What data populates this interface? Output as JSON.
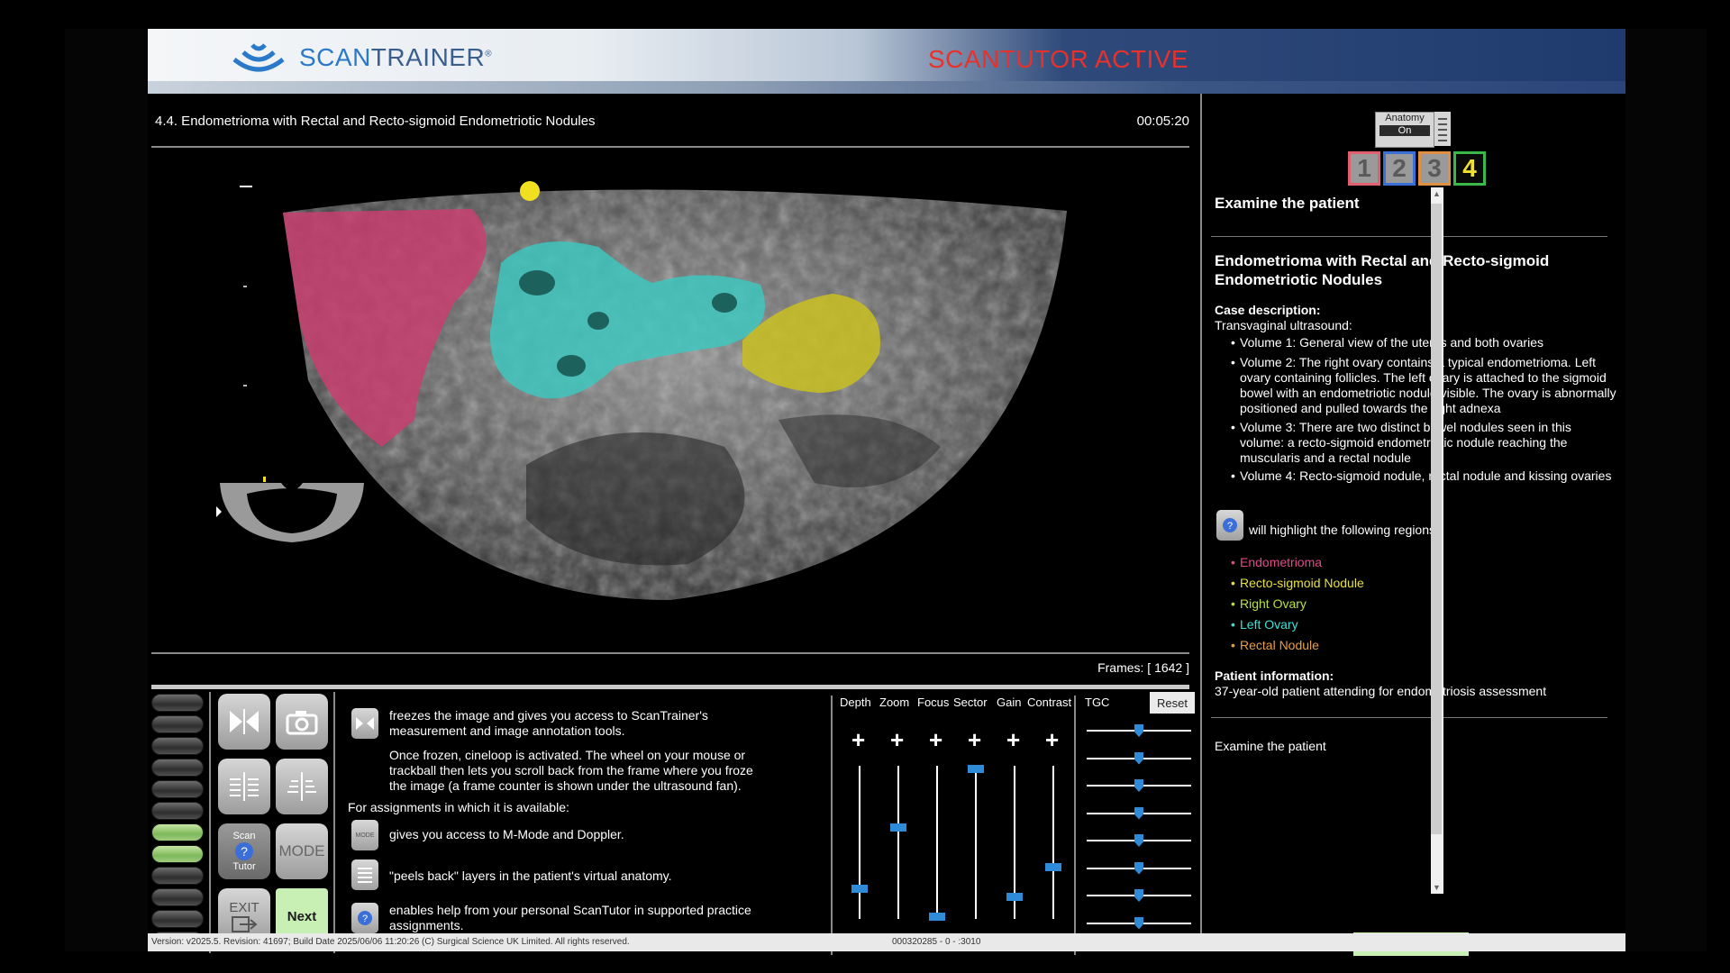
{
  "header": {
    "brand_pre": "SCAN",
    "brand_post": "TRAINER",
    "reg": "®",
    "mode_title": "SCANTUTOR ACTIVE"
  },
  "case": {
    "title": "4.4. Endometrioma with Rectal and Recto-sigmoid Endometriotic Nodules",
    "timer": "00:05:20",
    "frames": "Frames: [ 1642 ]"
  },
  "colors": {
    "endometrioma": "#c84070",
    "recto_sigmoid": "#c8c020",
    "right_ovary": "#b8d83a",
    "left_ovary": "#3ad0c8",
    "rectal_nodule": "#e0a040",
    "knob": "#2f8ad8",
    "next_bg": "#c8f0b4"
  },
  "tools": {
    "freeze_icon": "freeze-icon",
    "camera_icon": "camera-icon",
    "scan_tutor_top": "Scan",
    "scan_tutor_bottom": "Tutor",
    "mode": "MODE",
    "exit": "EXIT",
    "next": "Next"
  },
  "help": {
    "freeze_text": "freezes the image and gives you access to ScanTrainer's measurement and image annotation tools.",
    "cine_text": "Once frozen, cineloop is activated. The wheel on your mouse or trackball then lets you scroll back from the frame where you froze the image (a frame counter is shown under the ultrasound fan).",
    "assign_text": "For assignments in which it is available:",
    "mode_text": "gives you access to M-Mode and Doppler.",
    "layers_text": "\"peels back\" layers in the patient's virtual anatomy.",
    "tutor_text": "enables help from your personal ScanTutor in supported practice assignments."
  },
  "sliders": {
    "labels": [
      "Depth",
      "Zoom",
      "Focus",
      "Sector",
      "Gain",
      "Contrast"
    ],
    "levels": [
      0.2,
      0.6,
      0.02,
      0.98,
      0.15,
      0.34
    ],
    "tgc_label": "TGC",
    "tgc_levels": [
      0.5,
      0.5,
      0.5,
      0.5,
      0.5,
      0.5,
      0.5,
      0.5
    ],
    "reset": "Reset"
  },
  "anatomy": {
    "label": "Anatomy",
    "state": "On"
  },
  "volumes": [
    {
      "label": "1",
      "color": "#e06070",
      "bg": "#9a9a9a"
    },
    {
      "label": "2",
      "color": "#3a70d8",
      "bg": "#9a9a9a"
    },
    {
      "label": "3",
      "color": "#e09040",
      "bg": "#9a9a9a"
    },
    {
      "label": "4",
      "color": "#3ab84a",
      "bg": "#0a0a0a",
      "text": "#f0e030"
    }
  ],
  "panel": {
    "task": "Examine the patient",
    "case_title_1": "Endometrioma with Rectal and Recto-sigmoid",
    "case_title_2": "Endometriotic Nodules",
    "case_desc_label": "Case description:",
    "case_desc_intro": "Transvaginal ultrasound:",
    "volumes": [
      "Volume 1: General view of the uterus and both ovaries",
      "Volume 2: The right ovary contains a typical endometrioma. Left ovary containing follicles. The left ovary is attached to the sigmoid bowel with an endometriotic nodule visible. The ovary is abnormally positioned and pulled towards the right adnexa",
      "Volume 3: There are two distinct bowel nodules seen in this volume: a recto-sigmoid endometriotic nodule reaching the muscularis and a rectal nodule",
      "Volume 4: Recto-sigmoid nodule, rectal nodule and kissing ovaries"
    ],
    "highlight_text": "will highlight the following regions:",
    "regions": [
      {
        "label": "Endometrioma",
        "color": "#e04a88"
      },
      {
        "label": "Recto-sigmoid Nodule",
        "color": "#e8e040"
      },
      {
        "label": "Right Ovary",
        "color": "#b8e040"
      },
      {
        "label": "Left Ovary",
        "color": "#40e0d8"
      },
      {
        "label": "Rectal Nodule",
        "color": "#e8a040"
      }
    ],
    "patient_label": "Patient information:",
    "patient_text": "37-year-old patient attending for endometriosis assessment",
    "bottom_task": "Examine the patient",
    "next": "Next"
  },
  "footer": {
    "version": "Version: v2025.5. Revision: 41697; Build Date 2025/06/06 11:20:26 (C) Surgical Science UK Limited. All rights reserved.",
    "code": "000320285 - 0 - :3010"
  }
}
